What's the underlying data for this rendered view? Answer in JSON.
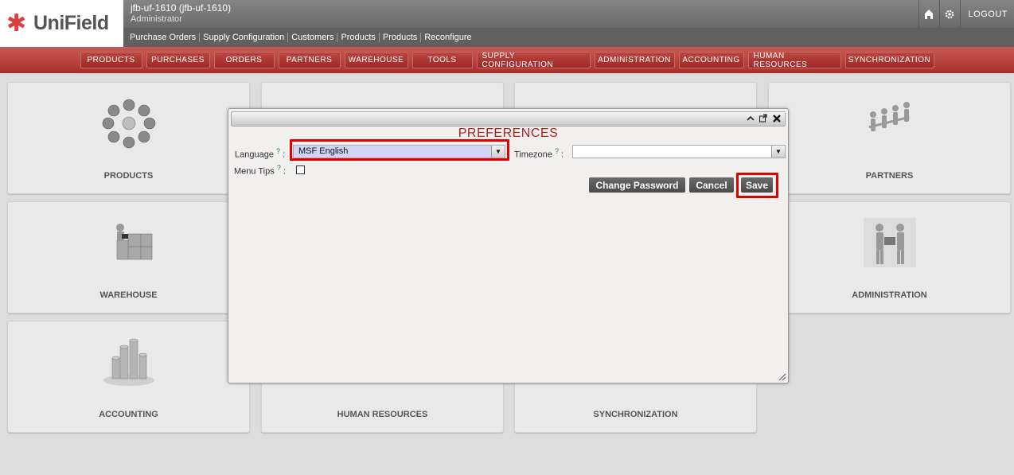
{
  "app": {
    "logo_text": "UniField",
    "db_name": "jfb-uf-1610 (jfb-uf-1610)",
    "user_name": "Administrator",
    "logout_label": "LOGOUT",
    "home_icon": "home-icon",
    "settings_icon": "gear-icon"
  },
  "shortcuts": [
    "Purchase Orders",
    "Supply Configuration",
    "Customers",
    "Products",
    "Products",
    "Reconfigure"
  ],
  "menu": [
    "PRODUCTS",
    "PURCHASES",
    "ORDERS",
    "PARTNERS",
    "WAREHOUSE",
    "TOOLS",
    "SUPPLY CONFIGURATION",
    "ADMINISTRATION",
    "ACCOUNTING",
    "HUMAN RESOURCES",
    "SYNCHRONIZATION"
  ],
  "tiles": {
    "products": "PRODUCTS",
    "partners": "PARTNERS",
    "warehouse": "WAREHOUSE",
    "administration": "ADMINISTRATION",
    "accounting": "ACCOUNTING",
    "human_resources": "HUMAN RESOURCES",
    "synchronization": "SYNCHRONIZATION"
  },
  "dialog": {
    "title": "PREFERENCES",
    "language_label": "Language",
    "language_value": "MSF English",
    "timezone_label": "Timezone",
    "timezone_value": "",
    "menu_tips_label": "Menu Tips",
    "help_mark": "?",
    "colon": ":",
    "menu_tips_checked": false,
    "buttons": {
      "change_password": "Change Password",
      "cancel": "Cancel",
      "save": "Save"
    },
    "highlight_color": "#e00000"
  },
  "colors": {
    "menu_red": "#b13a36",
    "title_red": "#b0201c"
  }
}
